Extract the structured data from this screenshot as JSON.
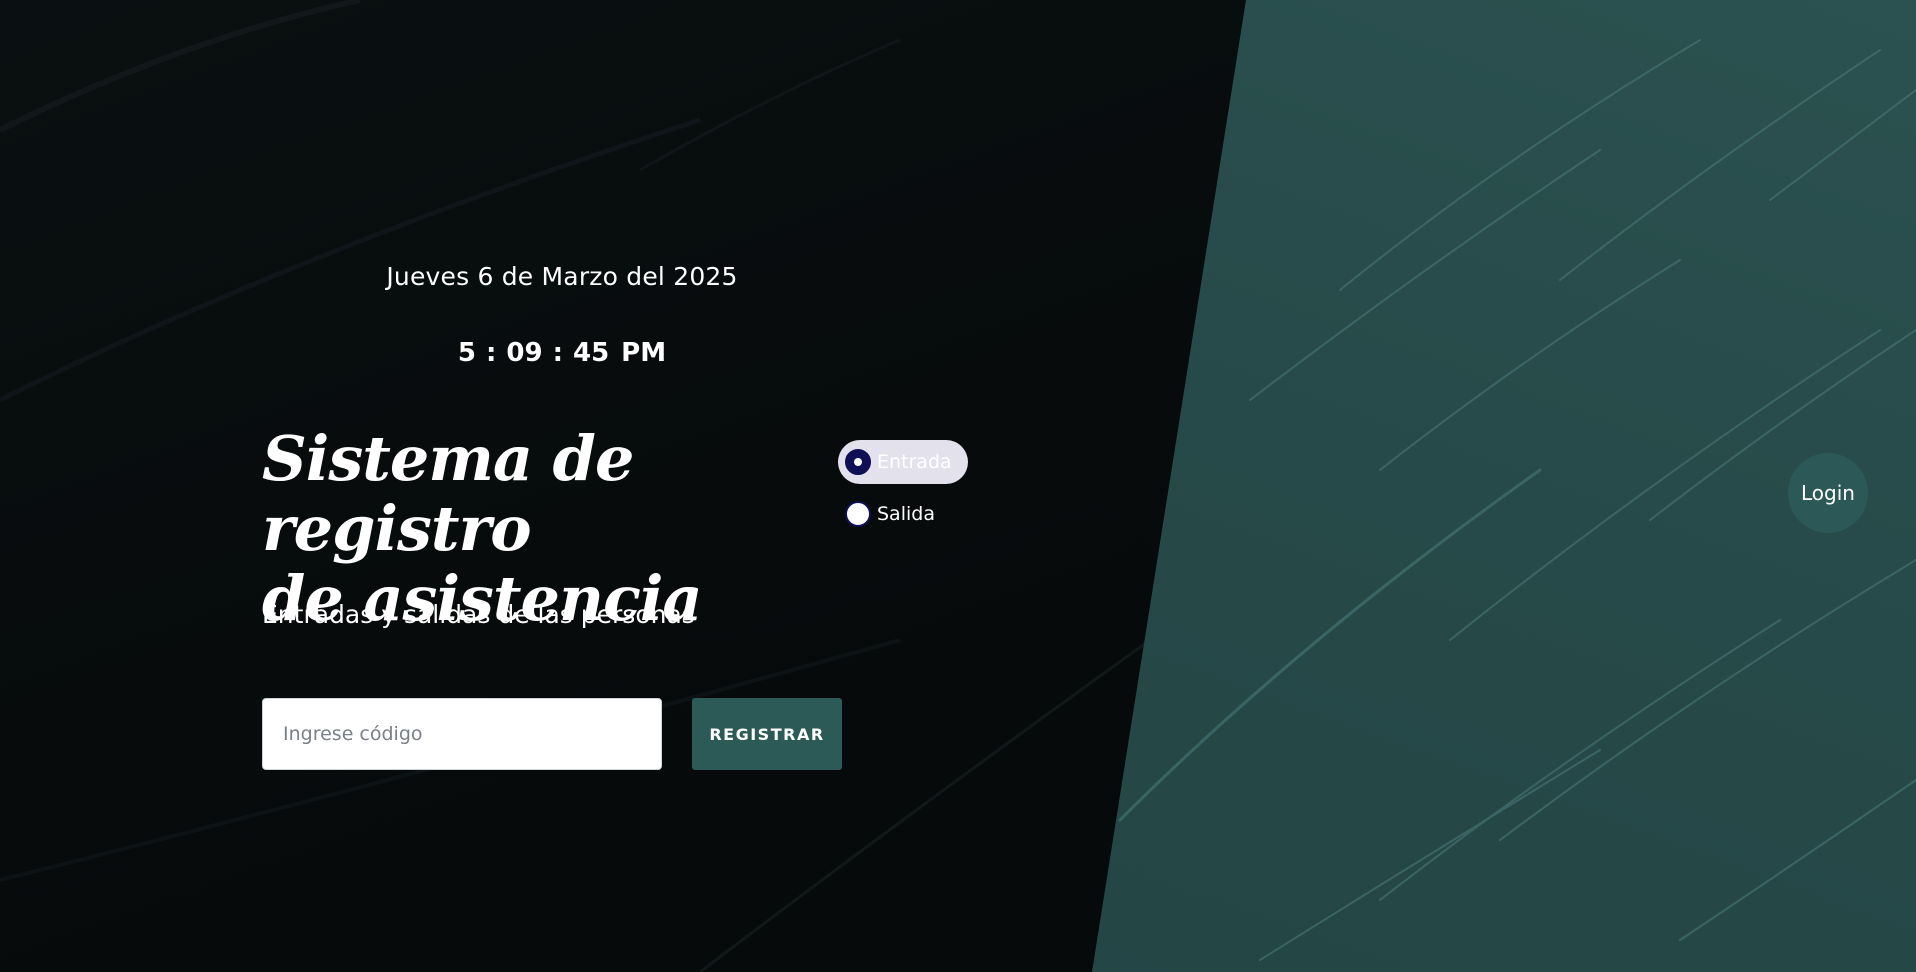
{
  "header": {
    "date": "Jueves 6 de Marzo del 2025",
    "clock": {
      "hours": "5",
      "minutes": "09",
      "seconds": "45",
      "separator": ":",
      "period": "PM"
    }
  },
  "hero": {
    "title_line1": "Sistema de registro",
    "title_line2": "de asistencia",
    "subtitle": "Entradas y salidas de las personas"
  },
  "mode_options": [
    {
      "label": "Entrada",
      "selected": true
    },
    {
      "label": "Salida",
      "selected": false
    }
  ],
  "form": {
    "code_placeholder": "Ingrese código",
    "code_value": "",
    "register_label": "REGISTRAR"
  },
  "login": {
    "label": "Login"
  },
  "colors": {
    "dark_background": "#070b0c",
    "teal_panel": "#264a49",
    "accent_button": "#2b5a57",
    "radio_selected": "#0f0f55",
    "radio_selected_bg": "#e3e1ec"
  }
}
